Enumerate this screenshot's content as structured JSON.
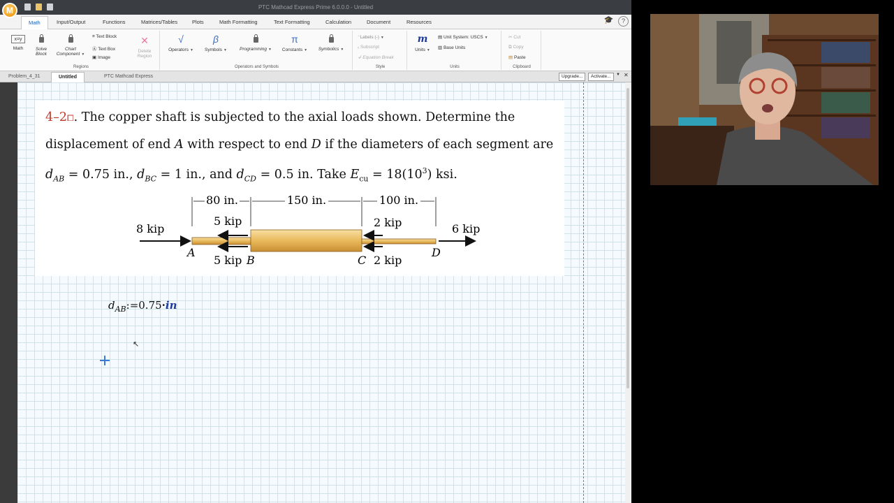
{
  "window": {
    "title": "PTC Mathcad Express Prime 6.0.0.0 - Untitled",
    "logo_letter": "M"
  },
  "ribbon_tabs": [
    "Math",
    "Input/Output",
    "Functions",
    "Matrices/Tables",
    "Plots",
    "Math Formatting",
    "Text Formatting",
    "Calculation",
    "Document",
    "Resources"
  ],
  "ribbon": {
    "regions": {
      "label": "Regions",
      "math": "Math",
      "math_icon_text": "x=y",
      "solve_block_1": "Solve",
      "solve_block_2": "Block",
      "chart_component_1": "Chart",
      "chart_component_2": "Component",
      "text_block": "Text Block",
      "text_box": "Text Box",
      "image": "Image",
      "delete_region_1": "Delete",
      "delete_region_2": "Region"
    },
    "operators_symbols": {
      "label": "Operators and Symbols",
      "operators": "Operators",
      "symbols": "Symbols",
      "programming": "Programming",
      "constants": "Constants",
      "symbolics": "Symbolics"
    },
    "style": {
      "label": "Style",
      "labels": "Labels",
      "labels_value": "(-)",
      "subscript": "Subscript",
      "equation_break": "Equation Break"
    },
    "units": {
      "label": "Units",
      "units": "Units",
      "unit_system": "Unit System:",
      "unit_system_value": "USCS",
      "base_units": "Base Units"
    },
    "clipboard": {
      "label": "Clipboard",
      "cut": "Cut",
      "copy": "Copy",
      "paste": "Paste"
    }
  },
  "doc_tabs": {
    "problem": "Problem_4_31",
    "untitled": "Untitled",
    "express": "PTC Mathcad Express",
    "upgrade": "Upgrade...",
    "activate": "Activate..."
  },
  "problem": {
    "number": "4–2",
    "text_1": ". The copper shaft is subjected to the axial loads shown. Determine the displacement of end ",
    "A": "A",
    "text_2": " with respect to end ",
    "D": "D",
    "text_3": " if the diameters of each segment are ",
    "d": "d",
    "sub_AB": "AB",
    "val_AB": " = 0.75 in., ",
    "sub_BC": "BC",
    "val_BC": " = 1 in., and ",
    "sub_CD": "CD",
    "val_CD": " = 0.5 in. Take ",
    "E": "E",
    "sub_cu": "cu",
    "val_E": " = 18(10",
    "exp": "3",
    "val_E_end": ") ksi."
  },
  "figure": {
    "dim_80": "80 in.",
    "dim_150": "150 in.",
    "dim_100": "100 in.",
    "load_8": "8 kip",
    "load_5_top": "5 kip",
    "load_5_bot": "5 kip",
    "load_2_top": "2 kip",
    "load_2_bot": "2 kip",
    "load_6": "6 kip",
    "pt_A": "A",
    "pt_B": "B",
    "pt_C": "C",
    "pt_D": "D"
  },
  "equation": {
    "var": "d",
    "sub": "AB",
    "assign": ":=",
    "value": "0.75",
    "dot": "·",
    "unit": "in"
  },
  "colors": {
    "accent": "#1a5fb4",
    "problem_number": "#c0392b",
    "shaft": "#e8b860",
    "unit_blue": "#1d3a99"
  }
}
